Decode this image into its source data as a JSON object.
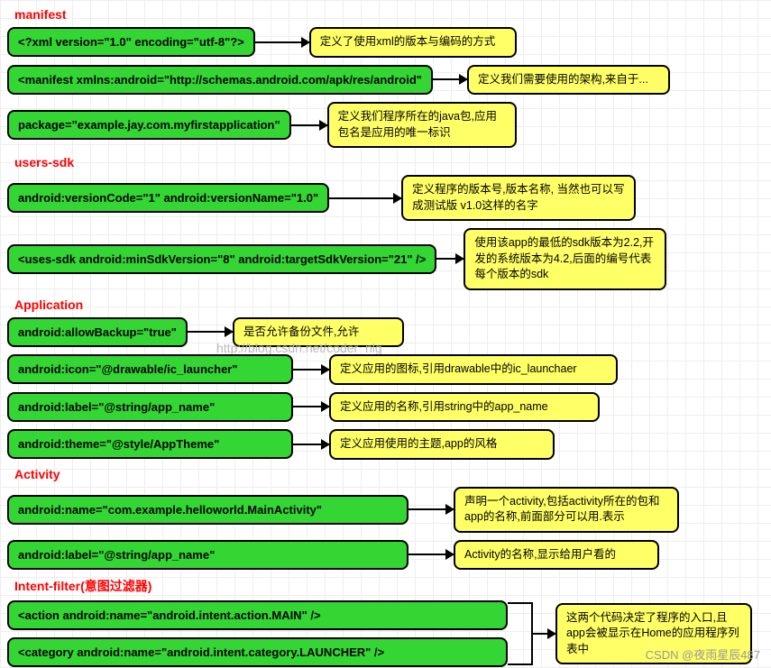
{
  "sections": {
    "manifest": {
      "title": "manifest"
    },
    "users_sdk": {
      "title": "users-sdk"
    },
    "application": {
      "title": "Application"
    },
    "activity": {
      "title": "Activity"
    },
    "intent_filter": {
      "title": "Intent-filter(意图过滤器)"
    }
  },
  "rows": {
    "xml_decl": {
      "code": "<?xml version=\"1.0\" encoding=\"utf-8\"?>",
      "desc": "定义了使用xml的版本与编码的方式"
    },
    "manifest_ns": {
      "code": "<manifest xmlns:android=\"http://schemas.android.com/apk/res/android\"",
      "desc": "定义我们需要使用的架构,来自于..."
    },
    "package": {
      "code": "package=\"example.jay.com.myfirstapplication\"",
      "desc": "定义我们程序所在的java包,应用包名是应用的唯一标识"
    },
    "version": {
      "code": "android:versionCode=\"1\"    android:versionName=\"1.0\"",
      "desc": "定义程序的版本号,版本名称, 当然也可以写成测试版 v1.0这样的名字"
    },
    "uses_sdk": {
      "code": "<uses-sdk  android:minSdkVersion=\"8\"  android:targetSdkVersion=\"21\" />",
      "desc": "使用该app的最低的sdk版本为2.2,开发的系统版本为4.2,后面的编号代表每个版本的sdk"
    },
    "backup": {
      "code": "android:allowBackup=\"true\"",
      "desc": "是否允许备份文件,允许"
    },
    "icon": {
      "code": "android:icon=\"@drawable/ic_launcher\"",
      "desc": "定义应用的图标,引用drawable中的ic_launchaer"
    },
    "label": {
      "code": "android:label=\"@string/app_name\"",
      "desc": "定义应用的名称,引用string中的app_name"
    },
    "theme": {
      "code": "android:theme=\"@style/AppTheme\"",
      "desc": "定义应用使用的主题,app的风格"
    },
    "act_name": {
      "code": "android:name=\"com.example.helloworld.MainActivity\"",
      "desc": "声明一个activity,包括activity所在的包和app的名称,前面部分可以用.表示"
    },
    "act_label": {
      "code": "android:label=\"@string/app_name\"",
      "desc": "Activity的名称,显示给用户看的"
    },
    "action": {
      "code": "<action android:name=\"android.intent.action.MAIN\" />"
    },
    "category": {
      "code": "<category android:name=\"android.intent.category.LAUNCHER\" />"
    },
    "intent_desc": "这两个代码决定了程序的入口,且app会被显示在Home的应用程序列表中"
  },
  "watermark": "http://blog.csdn.net/coder_nlg",
  "footer": "CSDN @夜雨星辰487"
}
